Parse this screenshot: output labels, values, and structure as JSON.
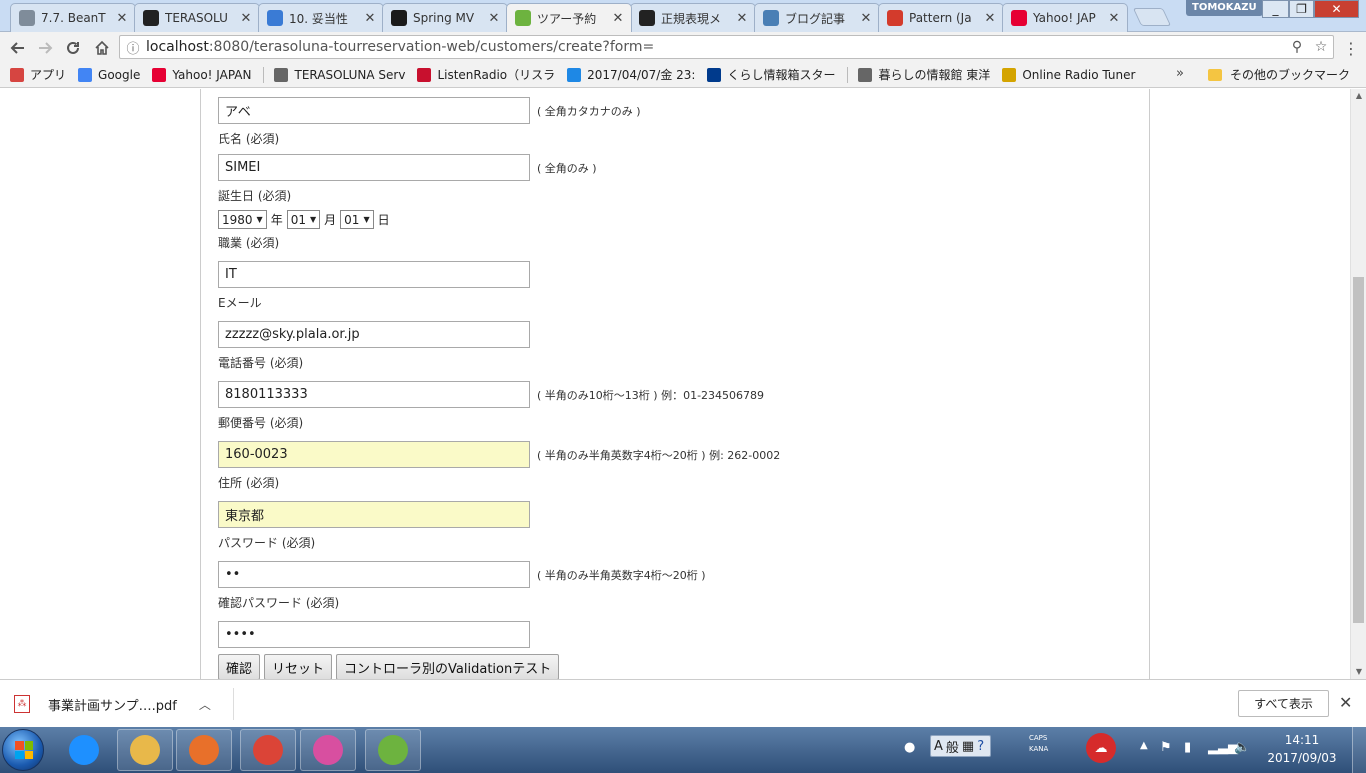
{
  "browser": {
    "tabs": [
      {
        "title": "7.7. BeanT",
        "icon": "document-icon",
        "color": "#7f8c9a",
        "active": false
      },
      {
        "title": "TERASOLU",
        "icon": "github-icon",
        "color": "#222222",
        "active": false
      },
      {
        "title": "10. 妥当性",
        "icon": "doc-blue-icon",
        "color": "#3a7bd5",
        "active": false
      },
      {
        "title": "Spring MV",
        "icon": "cp-icon",
        "color": "#1a1a1a",
        "active": false
      },
      {
        "title": "ツアー予約",
        "icon": "spring-leaf-icon",
        "color": "#6db33f",
        "active": true
      },
      {
        "title": "正規表現メ",
        "icon": "github-icon",
        "color": "#222222",
        "active": false
      },
      {
        "title": "ブログ記事",
        "icon": "wrench-icon",
        "color": "#4a7fb5",
        "active": false
      },
      {
        "title": "Pattern (Ja",
        "icon": "oracle-icon",
        "color": "#d33b2c",
        "active": false
      },
      {
        "title": "Yahoo! JAP",
        "icon": "yahoo-icon",
        "color": "#e60033",
        "active": false
      }
    ],
    "user_badge": "TOMOKAZU",
    "address": {
      "host": "localhost",
      "rest": ":8080/terasoluna-tourreservation-web/customers/create?form="
    },
    "bookmarks": [
      {
        "label": "アプリ",
        "icon": "apps-grid-icon",
        "color": "#d64541"
      },
      {
        "label": "Google",
        "icon": "google-icon",
        "color": "#4285f4"
      },
      {
        "label": "Yahoo! JAPAN",
        "icon": "yahoo-icon",
        "color": "#e60033"
      },
      {
        "label": "TERASOLUNA Serv",
        "icon": "page-icon",
        "color": "#666666"
      },
      {
        "label": "ListenRadio（リスラ",
        "icon": "listenradio-icon",
        "color": "#c8102e"
      },
      {
        "label": "2017/04/07/金 23:",
        "icon": "calendar-icon",
        "color": "#1e88e5"
      },
      {
        "label": "くらし情報箱スター",
        "icon": "pc-icon",
        "color": "#003a8c"
      },
      {
        "label": "暮らしの情報館 東洋",
        "icon": "page-icon",
        "color": "#666666"
      },
      {
        "label": "Online Radio Tuner",
        "icon": "bars-icon",
        "color": "#d4a400"
      }
    ],
    "bookmarks_overflow": "»",
    "other_bookmarks": "その他のブックマーク"
  },
  "form": {
    "kana_value": "アベ",
    "kana_hint": "( 全角カタカナのみ )",
    "name_label": "氏名 (必須)",
    "name_value": "SIMEI",
    "name_hint": "( 全角のみ )",
    "birth_label": "誕生日 (必須)",
    "birth_year": "1980",
    "birth_year_unit": "年",
    "birth_month": "01",
    "birth_month_unit": "月",
    "birth_day": "01",
    "birth_day_unit": "日",
    "job_label": "職業 (必須)",
    "job_value": "IT",
    "email_label": "Eメール",
    "email_value": "zzzzz@sky.plala.or.jp",
    "tel_label": "電話番号 (必須)",
    "tel_value": "8180113333",
    "tel_hint": "( 半角のみ10桁～13桁 ) 例：01-234506789",
    "zip_label": "郵便番号 (必須)",
    "zip_value": "160-0023",
    "zip_hint": "( 半角のみ半角英数字4桁～20桁 ) 例: 262-0002",
    "address_label": "住所 (必須)",
    "address_value": "東京都",
    "password_label": "パスワード (必須)",
    "password_value": "••",
    "password_hint": "( 半角のみ半角英数字4桁～20桁 )",
    "confirm_label": "確認パスワード (必須)",
    "confirm_value": "••••",
    "highlight_color": "#fafac8",
    "buttons": {
      "confirm": "確認",
      "reset": "リセット",
      "validation_test": "コントローラ別のValidationテスト"
    }
  },
  "downloads": {
    "file_name": "事業計画サンプ….pdf",
    "show_all": "すべて表示"
  },
  "taskbar": {
    "apps": [
      {
        "name": "ie-icon",
        "color": "#1e90ff"
      },
      {
        "name": "explorer-icon",
        "color": "#e8b84a"
      },
      {
        "name": "media-player-icon",
        "color": "#e8702a"
      },
      {
        "name": "chrome-icon",
        "color": "#db4437"
      },
      {
        "name": "notepad-icon",
        "color": "#d84fa0"
      },
      {
        "name": "spring-tool-icon",
        "color": "#6db33f"
      }
    ],
    "ime_mode": "A",
    "ime_kana": "般",
    "caps": "CAPS",
    "kana": "KANA",
    "time": "14:11",
    "date": "2017/09/03"
  }
}
